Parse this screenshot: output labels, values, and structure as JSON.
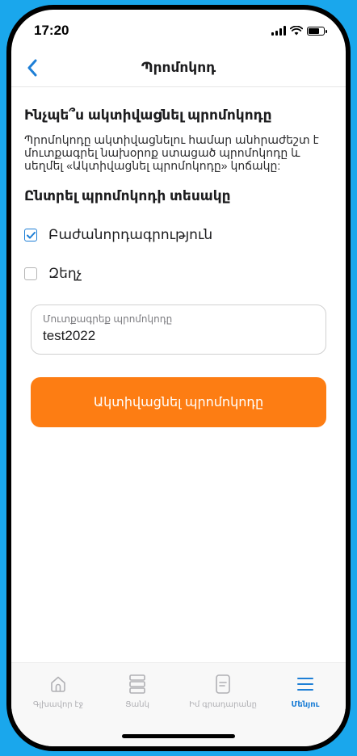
{
  "status_bar": {
    "time": "17:20"
  },
  "nav": {
    "title": "Պրոմոկոդ"
  },
  "content": {
    "heading": "Ինչպե՞ս ակտիվացնել պրոմոկոդը",
    "description": "Պրոմոկոդը ակտիվացնելու համար անհրաժեշտ է մուտքագրել նախօրոք ստացած պրոմոկոդը և սեղմել «Ակտիվացնել պրոմոկոդը» կոճակը:",
    "type_heading": "Ընտրել պրոմոկոդի տեսակը",
    "options": [
      {
        "label": "Բաժանորդագրություն",
        "checked": true
      },
      {
        "label": "Զեղչ",
        "checked": false
      }
    ],
    "promo_input": {
      "label": "Մուտքագրեք պրոմոկոդը",
      "value": "test2022"
    },
    "activate_button": "Ակտիվացնել պրոմոկոդը"
  },
  "tab_bar": {
    "tabs": [
      {
        "label": "Գլխավոր էջ",
        "icon": "home-icon",
        "active": false
      },
      {
        "label": "Ցանկ",
        "icon": "list-icon",
        "active": false
      },
      {
        "label": "Իմ գրադարանը",
        "icon": "library-icon",
        "active": false
      },
      {
        "label": "Մենյու",
        "icon": "menu-icon",
        "active": true
      }
    ]
  },
  "colors": {
    "accent": "#1e7fd6",
    "button": "#fd7d13",
    "background": "#1aa7ec"
  }
}
